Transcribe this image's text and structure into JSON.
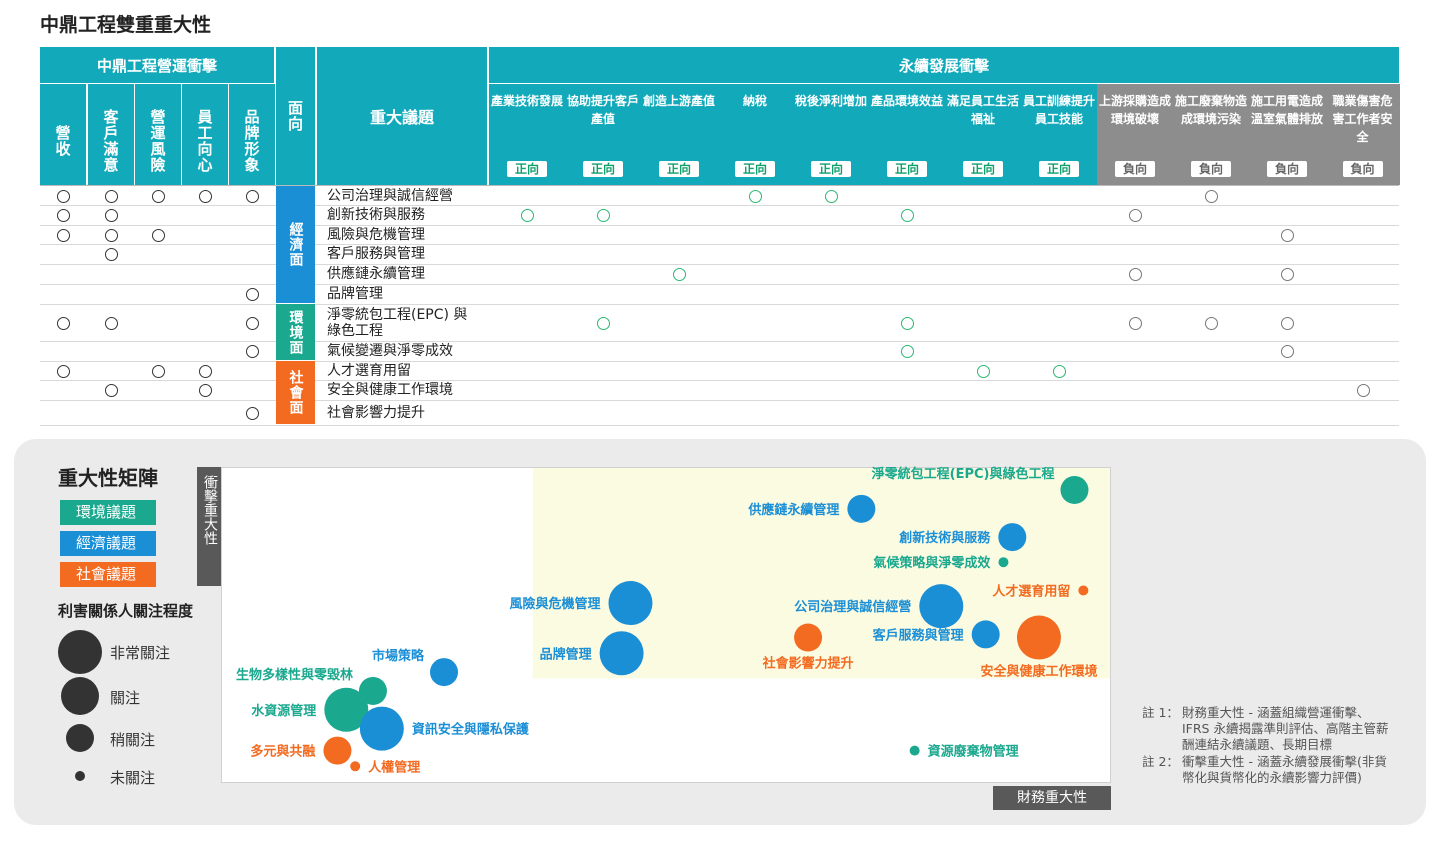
{
  "page_title": "中鼎工程雙重重大性",
  "table": {
    "group_operational": "中鼎工程營運衝擊",
    "group_sustain": "永續發展衝擊",
    "aspect_header": "面向",
    "topic_header": "重大議題",
    "operational_cols": [
      "營收",
      "客戶滿意",
      "營運風險",
      "員工向心",
      "品牌形象"
    ],
    "impact_cols": [
      {
        "label": "產業技術發展",
        "dir": "正向"
      },
      {
        "label": "協助提升客戶產值",
        "dir": "正向"
      },
      {
        "label": "創造上游產值",
        "dir": "正向"
      },
      {
        "label": "納稅",
        "dir": "正向"
      },
      {
        "label": "稅後淨利增加",
        "dir": "正向"
      },
      {
        "label": "產品環境效益",
        "dir": "正向"
      },
      {
        "label": "滿足員工生活福祉",
        "dir": "正向"
      },
      {
        "label": "員工訓練提升員工技能",
        "dir": "正向"
      },
      {
        "label": "上游採購造成環境破壞",
        "dir": "負向"
      },
      {
        "label": "施工廢棄物造成環境污染",
        "dir": "負向"
      },
      {
        "label": "施工用電造成溫室氣體排放",
        "dir": "負向"
      },
      {
        "label": "職業傷害危害工作者安全",
        "dir": "負向"
      }
    ],
    "aspects": [
      {
        "name": "經濟面",
        "color": "#1b8fd6"
      },
      {
        "name": "環境面",
        "color": "#1aa88e"
      },
      {
        "name": "社會面",
        "color": "#f26b21"
      }
    ],
    "rows": [
      {
        "topic": "公司治理與誠信經營",
        "ops": [
          1,
          1,
          1,
          1,
          1
        ],
        "imp": [
          0,
          0,
          0,
          1,
          1,
          0,
          0,
          0,
          0,
          1,
          0,
          0
        ]
      },
      {
        "topic": "創新技術與服務",
        "ops": [
          1,
          1,
          0,
          0,
          0
        ],
        "imp": [
          1,
          1,
          0,
          0,
          0,
          1,
          0,
          0,
          1,
          0,
          0,
          0
        ]
      },
      {
        "topic": "風險與危機管理",
        "ops": [
          1,
          1,
          1,
          0,
          0
        ],
        "imp": [
          0,
          0,
          0,
          0,
          0,
          0,
          0,
          0,
          0,
          0,
          1,
          0
        ]
      },
      {
        "topic": "客戶服務與管理",
        "ops": [
          0,
          1,
          0,
          0,
          0
        ],
        "imp": [
          0,
          0,
          0,
          0,
          0,
          0,
          0,
          0,
          0,
          0,
          0,
          0
        ]
      },
      {
        "topic": "供應鏈永續管理",
        "ops": [
          0,
          0,
          0,
          0,
          0
        ],
        "imp": [
          0,
          0,
          1,
          0,
          0,
          0,
          0,
          0,
          1,
          0,
          1,
          0
        ]
      },
      {
        "topic": "品牌管理",
        "ops": [
          0,
          0,
          0,
          0,
          1
        ],
        "imp": [
          0,
          0,
          0,
          0,
          0,
          0,
          0,
          0,
          0,
          0,
          0,
          0
        ]
      },
      {
        "topic_line1": "淨零統包工程(EPC) 與",
        "topic_line2": "綠色工程",
        "ops": [
          1,
          1,
          0,
          0,
          1
        ],
        "imp": [
          0,
          1,
          0,
          0,
          0,
          1,
          0,
          0,
          1,
          1,
          1,
          0
        ]
      },
      {
        "topic": "氣候變遷與淨零成效",
        "ops": [
          0,
          0,
          0,
          0,
          1
        ],
        "imp": [
          0,
          0,
          0,
          0,
          0,
          1,
          0,
          0,
          0,
          0,
          1,
          0
        ]
      },
      {
        "topic": "人才選育用留",
        "ops": [
          1,
          0,
          1,
          1,
          0
        ],
        "imp": [
          0,
          0,
          0,
          0,
          0,
          0,
          1,
          1,
          0,
          0,
          0,
          0
        ]
      },
      {
        "topic": "安全與健康工作環境",
        "ops": [
          0,
          1,
          0,
          1,
          0
        ],
        "imp": [
          0,
          0,
          0,
          0,
          0,
          0,
          0,
          0,
          0,
          0,
          0,
          1
        ]
      },
      {
        "topic": "社會影響力提升",
        "ops": [
          0,
          0,
          0,
          0,
          1
        ],
        "imp": [
          0,
          0,
          0,
          0,
          0,
          0,
          0,
          0,
          0,
          0,
          0,
          0
        ]
      }
    ]
  },
  "legend": {
    "title": "重大性矩陣",
    "categories": [
      {
        "label": "環境議題",
        "color": "#1aa88e"
      },
      {
        "label": "經濟議題",
        "color": "#1b8fd6"
      },
      {
        "label": "社會議題",
        "color": "#f26b21"
      }
    ],
    "size_title": "利害關係人關注程度",
    "sizes": [
      "非常關注",
      "關注",
      "稍關注",
      "未關注"
    ]
  },
  "chart_data": {
    "type": "scatter",
    "title": "重大性矩陣",
    "xlabel": "財務重大性",
    "ylabel": "衝擊重大性",
    "xlim": [
      0,
      100
    ],
    "ylim": [
      0,
      100
    ],
    "highlight_region": {
      "x": [
        35,
        100
      ],
      "y": [
        33,
        100
      ]
    },
    "size_levels": [
      "非常關注",
      "關注",
      "稍關注",
      "未關注"
    ],
    "points": [
      {
        "label": "淨零統包工程(EPC)與綠色工程",
        "category": "環境議題",
        "x": 96,
        "y": 93,
        "size": "關注"
      },
      {
        "label": "供應鏈永續管理",
        "category": "經濟議題",
        "x": 72,
        "y": 87,
        "size": "關注"
      },
      {
        "label": "創新技術與服務",
        "category": "經濟議題",
        "x": 89,
        "y": 78,
        "size": "關注"
      },
      {
        "label": "氣候策略與淨零成效",
        "category": "環境議題",
        "x": 88,
        "y": 70,
        "size": "未關注"
      },
      {
        "label": "人才選育用留",
        "category": "社會議題",
        "x": 97,
        "y": 61,
        "size": "未關注"
      },
      {
        "label": "風險與危機管理",
        "category": "經濟議題",
        "x": 46,
        "y": 57,
        "size": "非常關注"
      },
      {
        "label": "公司治理與誠信經營",
        "category": "經濟議題",
        "x": 81,
        "y": 56,
        "size": "非常關注"
      },
      {
        "label": "客戶服務與管理",
        "category": "經濟議題",
        "x": 86,
        "y": 47,
        "size": "關注"
      },
      {
        "label": "社會影響力提升",
        "category": "社會議題",
        "x": 66,
        "y": 46,
        "size": "關注"
      },
      {
        "label": "安全與健康工作環境",
        "category": "社會議題",
        "x": 92,
        "y": 46,
        "size": "非常關注"
      },
      {
        "label": "品牌管理",
        "category": "經濟議題",
        "x": 45,
        "y": 41,
        "size": "非常關注"
      },
      {
        "label": "市場策略",
        "category": "經濟議題",
        "x": 25,
        "y": 35,
        "size": "關注"
      },
      {
        "label": "生物多樣性與零毀林",
        "category": "環境議題",
        "x": 17,
        "y": 29,
        "size": "稍關注"
      },
      {
        "label": "水資源管理",
        "category": "環境議題",
        "x": 14,
        "y": 23,
        "size": "非常關注"
      },
      {
        "label": "資訊安全與隱私保護",
        "category": "經濟議題",
        "x": 18,
        "y": 17,
        "size": "非常關注"
      },
      {
        "label": "多元與共融",
        "category": "社會議題",
        "x": 13,
        "y": 10,
        "size": "稍關注"
      },
      {
        "label": "人權管理",
        "category": "社會議題",
        "x": 15,
        "y": 5,
        "size": "未關注"
      },
      {
        "label": "資源廢棄物管理",
        "category": "環境議題",
        "x": 78,
        "y": 10,
        "size": "未關注"
      }
    ]
  },
  "notes": [
    {
      "tag": "註 1：",
      "lines": [
        "財務重大性 - 涵蓋組織營運衝擊、",
        "IFRS 永續揭露準則評估、高階主管薪",
        "酬連結永續議題、長期目標"
      ]
    },
    {
      "tag": "註 2：",
      "lines": [
        "衝擊重大性 - 涵蓋永續發展衝擊(非貨",
        "幣化與貨幣化的永續影響力評價)"
      ]
    }
  ]
}
